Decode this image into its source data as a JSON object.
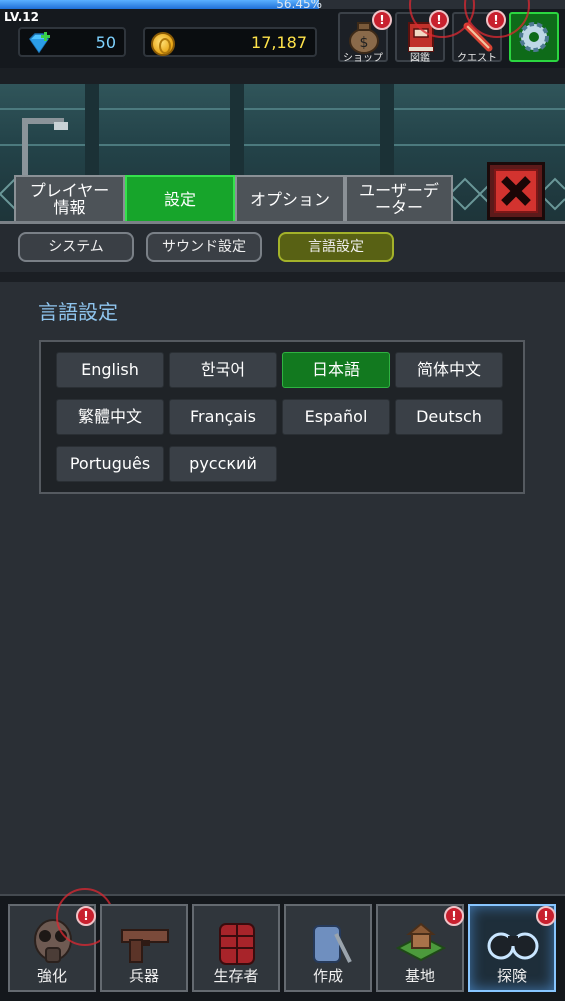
{
  "hud": {
    "level": "LV.12",
    "xp_percent_text": "56.45%",
    "xp_fraction": 0.5645,
    "gems": "50",
    "gold": "17,187",
    "shop_label": "ショップ",
    "book_label": "図鑑",
    "quest_label": "クエスト",
    "alert_mark": "!"
  },
  "tabs": {
    "player_line1": "プレイヤー",
    "player_line2": "情報",
    "settings": "設定",
    "option": "オプション",
    "user_line1": "ユーザーデ",
    "user_line2": "ーター"
  },
  "subtabs": {
    "system": "システム",
    "sound": "サウンド設定",
    "language": "言語設定"
  },
  "panel": {
    "title": "言語設定",
    "languages": [
      "English",
      "한국어",
      "日本語",
      "简体中文",
      "繁體中文",
      "Français",
      "Español",
      "Deutsch",
      "Português",
      "русский"
    ],
    "selected": "日本語"
  },
  "bottom_nav": {
    "upgrade": "強化",
    "weapons": "兵器",
    "survivors": "生存者",
    "craft": "作成",
    "base": "基地",
    "explore": "探険"
  },
  "colors": {
    "accent_green": "#17a52b",
    "selected_language": "#12791f",
    "title_blue": "#8fc5ee",
    "gold_text": "#ffe34a",
    "gem_text": "#7fd3ff",
    "alert_red": "#c8202e"
  }
}
